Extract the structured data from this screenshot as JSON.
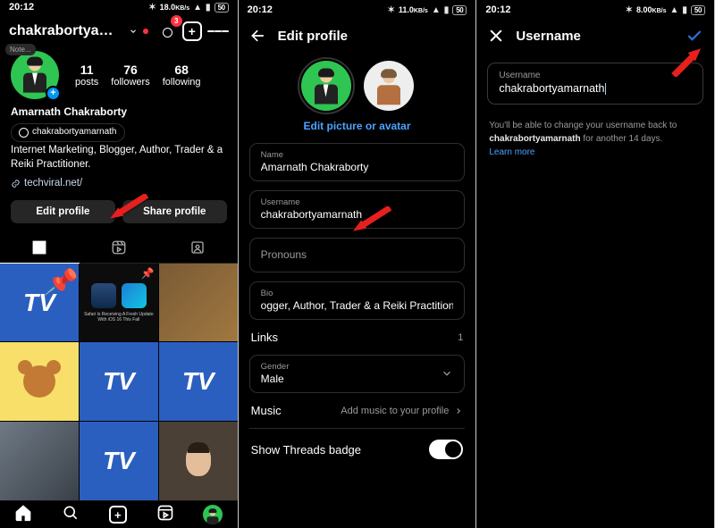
{
  "status": {
    "time": "20:12",
    "net": "18.0",
    "net_unit": "KB/s",
    "battery": "50"
  },
  "s1": {
    "header_username": "chakrabortyamarn...",
    "notification_badge": "3",
    "note_label": "Note...",
    "posts_n": "11",
    "posts_l": "posts",
    "followers_n": "76",
    "followers_l": "followers",
    "following_n": "68",
    "following_l": "following",
    "display_name": "Amarnath Chakraborty",
    "threads_handle": "chakrabortyamarnath",
    "bio": "Internet Marketing, Blogger, Author, Trader & a Reiki Practitioner.",
    "link": "techviral.net/",
    "edit_btn": "Edit profile",
    "share_btn": "Share profile"
  },
  "s2": {
    "title": "Edit profile",
    "edit_picture": "Edit picture or avatar",
    "name_lbl": "Name",
    "name_val": "Amarnath Chakraborty",
    "username_lbl": "Username",
    "username_val": "chakrabortyamarnath",
    "pronouns_lbl": "Pronouns",
    "bio_lbl": "Bio",
    "bio_val": "ogger, Author, Trader & a Reiki Practitioner.",
    "links_lbl": "Links",
    "links_count": "1",
    "gender_lbl": "Gender",
    "gender_val": "Male",
    "music_lbl": "Music",
    "music_hint": "Add music to your profile",
    "threads_lbl": "Show Threads badge"
  },
  "s3": {
    "title": "Username",
    "field_lbl": "Username",
    "field_val": "chakrabortyamarnath",
    "hint_a": "You'll be able to change your username back to ",
    "hint_user": "chakrabortyamarnath",
    "hint_b": " for another 14 days.",
    "learn": "Learn more"
  },
  "status2": {
    "net": "11.0"
  },
  "status3": {
    "net": "8.00"
  }
}
